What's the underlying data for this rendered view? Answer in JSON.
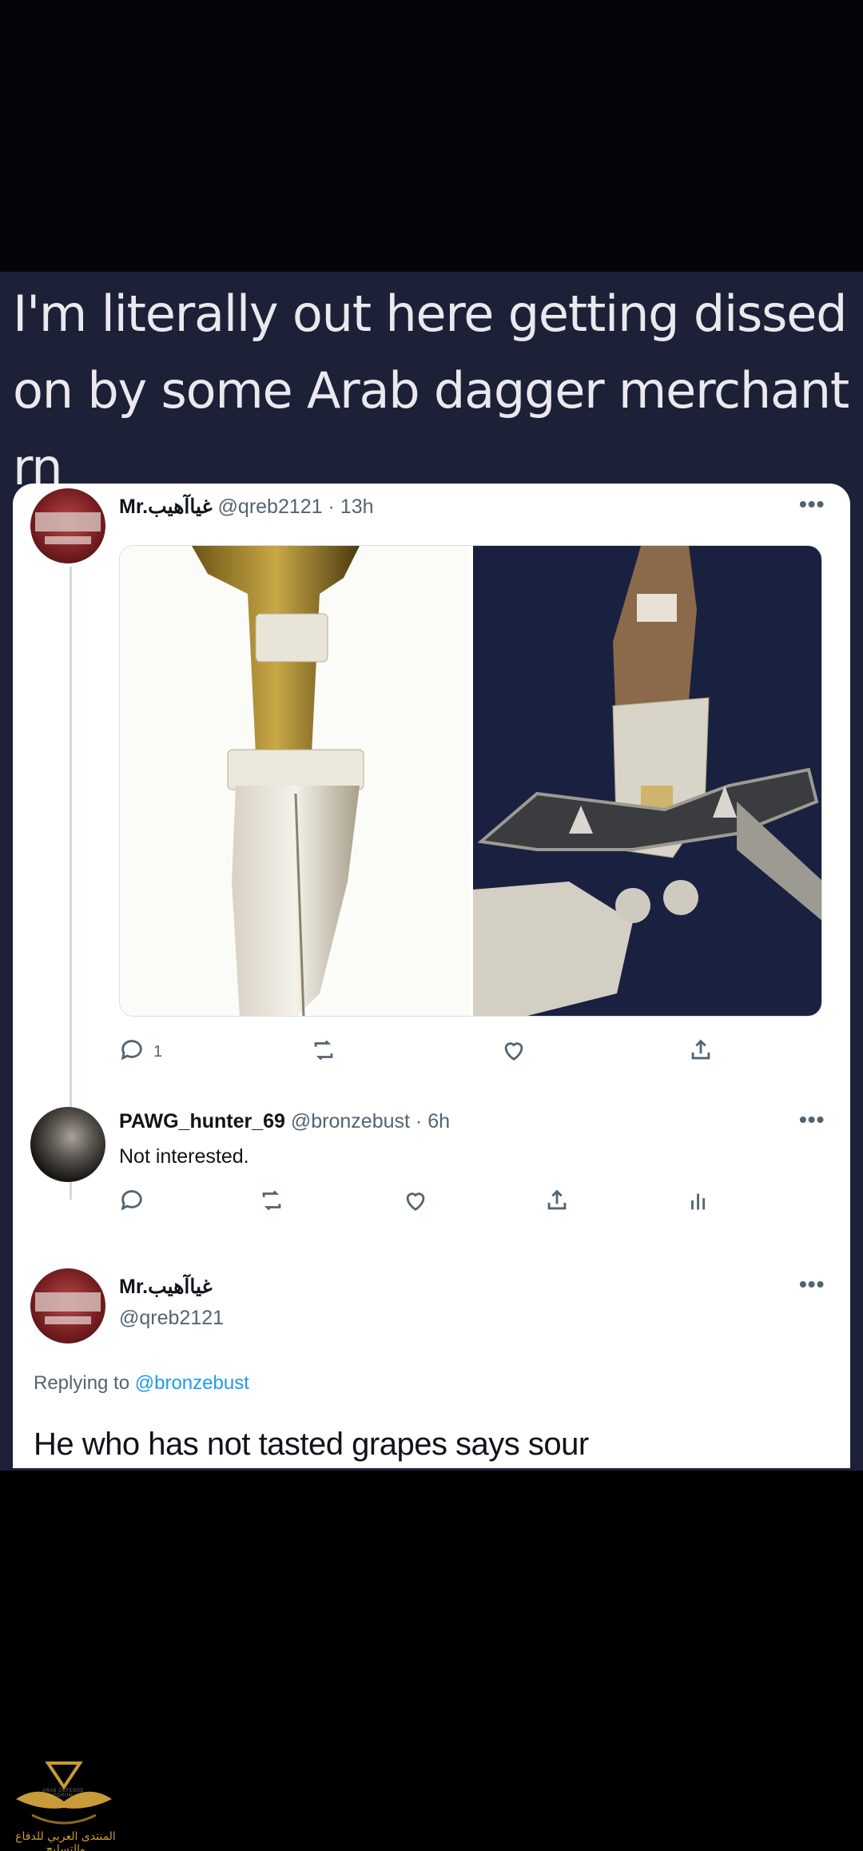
{
  "caption": "I'm literally out here getting dissed on by some Arab dagger merchant rn",
  "tweet": {
    "name": "Mr.غياآهيب",
    "handle": "@qreb2121",
    "time": "13h",
    "more": "•••",
    "reply_count": "1"
  },
  "reply1": {
    "name": "PAWG_hunter_69",
    "handle": "@bronzebust",
    "time": "6h",
    "text": "Not interested.",
    "more": "•••"
  },
  "reply2": {
    "name": "Mr.غياآهيب",
    "handle": "@qreb2121",
    "replying_prefix": "Replying to",
    "replying_to": "@bronzebust",
    "text": "He who has not tasted grapes says sour",
    "more": "•••"
  },
  "watermark": {
    "small": "ARAB DEFENSE FORUM",
    "text": "المنتدى العربي للدفاع والتسليح"
  },
  "colors": {
    "band": "#1d2137",
    "text_primary": "#0f1419",
    "text_secondary": "#536471",
    "link": "#1d9bf0",
    "gold": "#c99a3a"
  },
  "icons": [
    "reply-icon",
    "retweet-icon",
    "like-icon",
    "share-icon",
    "views-icon",
    "more-icon"
  ]
}
